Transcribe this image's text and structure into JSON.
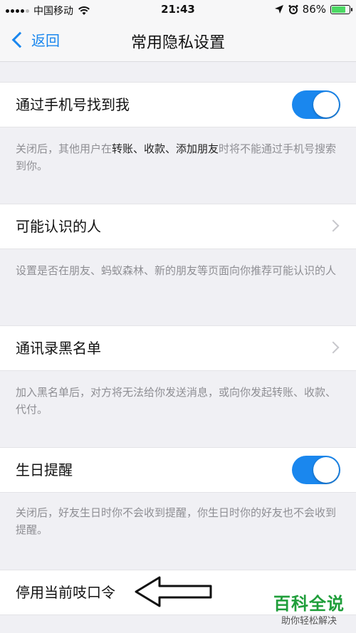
{
  "status_bar": {
    "carrier": "中国移动",
    "time": "21:43",
    "battery_percent": "86%",
    "battery_level": 0.86
  },
  "nav": {
    "back_label": "返回",
    "title": "常用隐私设置"
  },
  "settings": {
    "find_by_phone": {
      "label": "通过手机号找到我",
      "enabled": true,
      "desc_pre": "关闭后，其他用户在",
      "desc_bold": "转账、收款、添加朋友",
      "desc_post": "时将不能通过手机号搜索到你。"
    },
    "people_you_may_know": {
      "label": "可能认识的人",
      "desc": "设置是否在朋友、蚂蚁森林、新的朋友等页面向你推荐可能认识的人"
    },
    "contacts_blacklist": {
      "label": "通讯录黑名单",
      "desc": "加入黑名单后，对方将无法给你发送消息，或向你发起转账、收款、代付。"
    },
    "birthday_reminder": {
      "label": "生日提醒",
      "enabled": true,
      "desc": "关闭后，好友生日时你不会收到提醒，你生日时你的好友也不会收到提醒。"
    },
    "disable_password": {
      "label": "停用当前吱口令"
    }
  },
  "watermark": {
    "title": "百科全说",
    "subtitle": "助你轻松解决"
  },
  "colors": {
    "accent": "#1a87ee",
    "toggle_on": "#1a87ee",
    "watermark": "#1f9e3a"
  }
}
